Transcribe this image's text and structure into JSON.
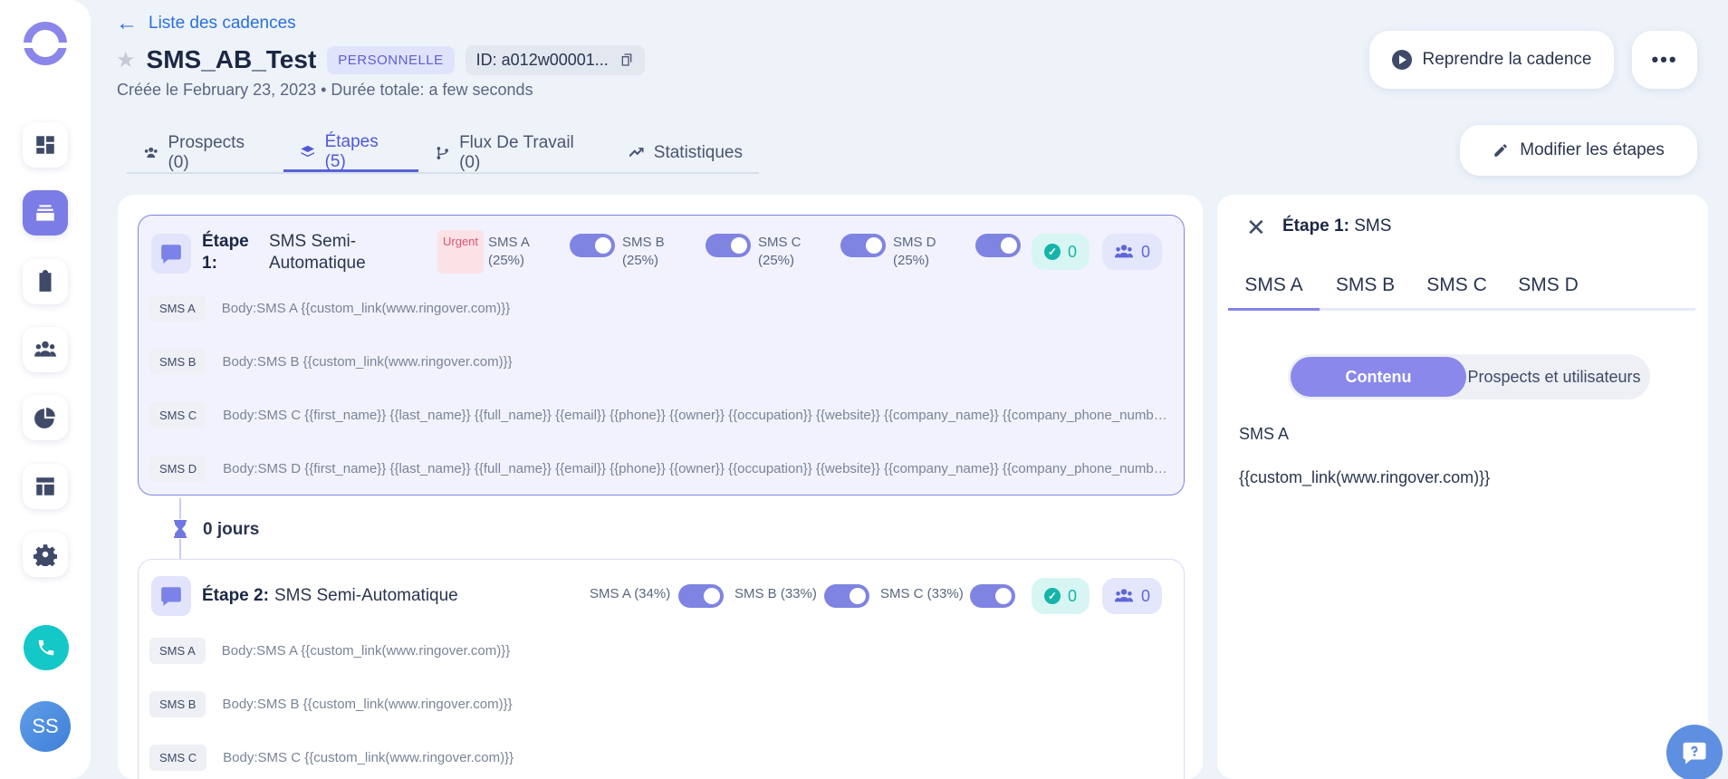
{
  "sidebar": {
    "avatar_initials": "SS",
    "items": [
      {
        "icon": "dashboard-icon"
      },
      {
        "icon": "cadences-icon",
        "active": true
      },
      {
        "icon": "tasks-icon"
      },
      {
        "icon": "people-icon"
      },
      {
        "icon": "stats-icon"
      },
      {
        "icon": "templates-icon"
      },
      {
        "icon": "gear-icon"
      }
    ]
  },
  "header": {
    "back_label": "Liste des cadences",
    "title": "SMS_AB_Test",
    "badge": "PERSONNELLE",
    "id_text": "ID: a012w00001...",
    "subtitle": "Créée le February 23, 2023 • Durée totale: a few seconds",
    "resume_label": "Reprendre la cadence",
    "more_label": "•••",
    "edit_label": "Modifier les étapes"
  },
  "tabs": [
    {
      "label": "Prospects (0)",
      "icon": "people-icon"
    },
    {
      "label": "Étapes (5)",
      "icon": "layers-icon",
      "active": true
    },
    {
      "label": "Flux De Travail (0)",
      "icon": "flow-icon"
    },
    {
      "label": "Statistiques",
      "icon": "trend-icon"
    }
  ],
  "steps": [
    {
      "label": "Étape 1:",
      "type": "SMS Semi-Automatique",
      "urgent": "Urgent",
      "variants": [
        "SMS A (25%)",
        "SMS B (25%)",
        "SMS C (25%)",
        "SMS D (25%)"
      ],
      "done_count": "0",
      "people_count": "0",
      "rows": [
        {
          "tag": "SMS A",
          "body": "Body:SMS A {{custom_link(www.ringover.com)}}"
        },
        {
          "tag": "SMS B",
          "body": "Body:SMS B {{custom_link(www.ringover.com)}}"
        },
        {
          "tag": "SMS C",
          "body": "Body:SMS C {{first_name}} {{last_name}} {{full_name}} {{email}} {{phone}} {{owner}} {{occupation}} {{website}} {{company_name}} {{company_phone_number}}"
        },
        {
          "tag": "SMS D",
          "body": "Body:SMS D {{first_name}} {{last_name}} {{full_name}} {{email}} {{phone}} {{owner}} {{occupation}} {{website}} {{company_name}} {{company_phone_number}}"
        }
      ]
    },
    {
      "label": "Étape 2:",
      "type": "SMS Semi-Automatique",
      "variants": [
        "SMS A (34%)",
        "SMS B (33%)",
        "SMS C (33%)"
      ],
      "done_count": "0",
      "people_count": "0",
      "rows": [
        {
          "tag": "SMS A",
          "body": "Body:SMS A {{custom_link(www.ringover.com)}}"
        },
        {
          "tag": "SMS B",
          "body": "Body:SMS B {{custom_link(www.ringover.com)}}"
        },
        {
          "tag": "SMS C",
          "body": "Body:SMS C {{custom_link(www.ringover.com)}}"
        }
      ]
    }
  ],
  "delay": {
    "label": "0 jours"
  },
  "panel": {
    "title_bold": "Étape 1:",
    "title_rest": "SMS",
    "tabs": [
      "SMS A",
      "SMS B",
      "SMS C",
      "SMS D"
    ],
    "switch": [
      "Contenu",
      "Prospects et utilisateurs"
    ],
    "content_title": "SMS A",
    "content_body": "{{custom_link(www.ringover.com)}}"
  },
  "colors": {
    "accent": "#7c7ce6",
    "link": "#2b6fde",
    "teal": "#14c8c8"
  }
}
